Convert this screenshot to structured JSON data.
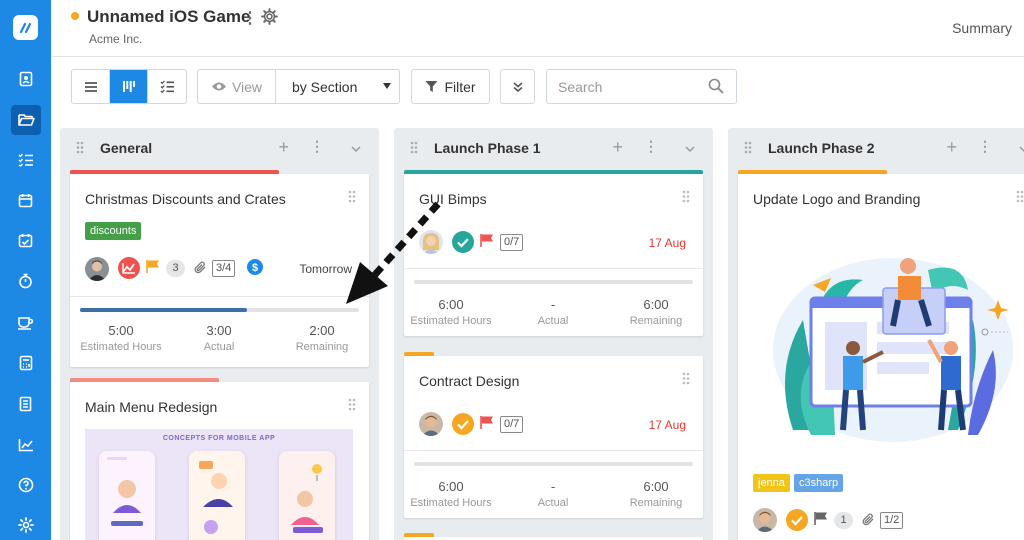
{
  "app": {
    "brand_color": "#1e88e5"
  },
  "header": {
    "project_title": "Unnamed iOS Game",
    "company": "Acme Inc.",
    "summary_link": "Summary",
    "status_color": "#f5a623"
  },
  "sidebar": {
    "items": [
      "contacts-icon",
      "folder-icon",
      "task-list-icon",
      "calendar-icon",
      "calendar-check-icon",
      "stopwatch-icon",
      "coffee-icon",
      "calculator-icon",
      "document-icon",
      "chart-icon",
      "help-icon",
      "gear-icon"
    ],
    "active_index": 1
  },
  "toolbar": {
    "view_label": "View",
    "view_select_value": "by Section",
    "filter_label": "Filter",
    "search_placeholder": "Search"
  },
  "board": {
    "columns": [
      {
        "title": "General",
        "cards": [
          {
            "title": "Christmas Discounts and Crates",
            "bar_color": "#ef5350",
            "tag": {
              "label": "discounts",
              "color": "#43a047"
            },
            "comments": "3",
            "checklist": "3/4",
            "due": "Tomorrow",
            "progress_fraction": 0.6,
            "stats": [
              {
                "value": "5:00",
                "label": "Estimated Hours"
              },
              {
                "value": "3:00",
                "label": "Actual"
              },
              {
                "value": "2:00",
                "label": "Remaining"
              }
            ]
          },
          {
            "title": "Main Menu Redesign",
            "bar_color": "#f28b82",
            "image_caption": "CONCEPTS FOR MOBILE APP"
          }
        ]
      },
      {
        "title": "Launch Phase 1",
        "cards": [
          {
            "title": "GUI Bimps",
            "bar_color": "#26a69a",
            "checklist": "0/7",
            "due": "17 Aug",
            "progress_fraction": 0,
            "stats": [
              {
                "value": "6:00",
                "label": "Estimated Hours"
              },
              {
                "value": "-",
                "label": "Actual"
              },
              {
                "value": "6:00",
                "label": "Remaining"
              }
            ]
          },
          {
            "title": "Contract Design",
            "bar_color": "#f5a623",
            "checklist": "0/7",
            "due": "17 Aug",
            "progress_fraction": 0,
            "stats": [
              {
                "value": "6:00",
                "label": "Estimated Hours"
              },
              {
                "value": "-",
                "label": "Actual"
              },
              {
                "value": "6:00",
                "label": "Remaining"
              }
            ]
          }
        ]
      },
      {
        "title": "Launch Phase 2",
        "cards": [
          {
            "title": "Update Logo and Branding",
            "bar_color": "#f5a623",
            "tags": [
              {
                "label": "jenna",
                "color": "#f0c419"
              },
              {
                "label": "c3sharp",
                "color": "#64a5e8"
              }
            ],
            "comments": "1",
            "checklist": "1/2"
          }
        ]
      }
    ]
  }
}
